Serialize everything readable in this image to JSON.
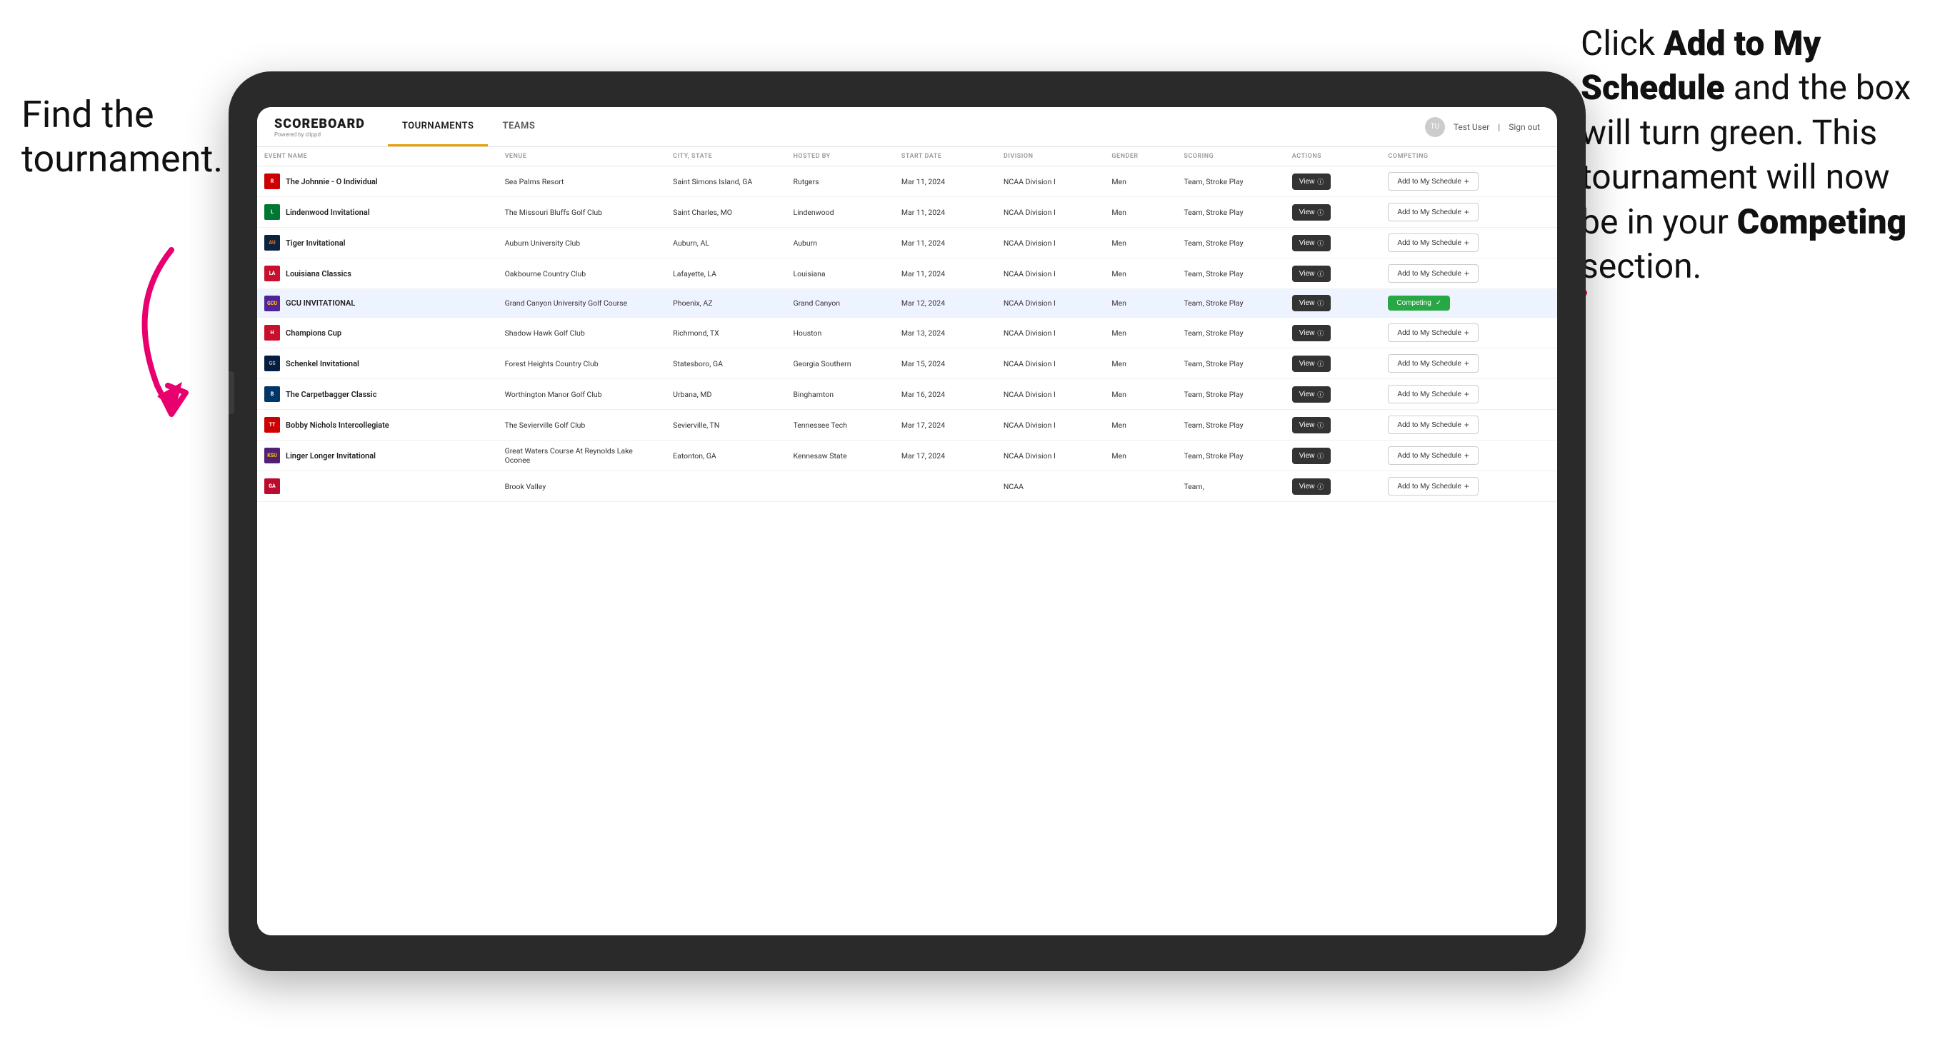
{
  "annotations": {
    "left_title": "Find the tournament.",
    "right_title_part1": "Click ",
    "right_bold1": "Add to My Schedule",
    "right_part2": " and the box will turn green. This tournament will now be in your ",
    "right_bold2": "Competing",
    "right_part3": " section."
  },
  "header": {
    "logo": "SCOREBOARD",
    "logo_sub": "Powered by clippd",
    "nav": [
      "TOURNAMENTS",
      "TEAMS"
    ],
    "active_nav": "TOURNAMENTS",
    "user": "Test User",
    "sign_out": "Sign out"
  },
  "table": {
    "columns": [
      "EVENT NAME",
      "VENUE",
      "CITY, STATE",
      "HOSTED BY",
      "START DATE",
      "DIVISION",
      "GENDER",
      "SCORING",
      "ACTIONS",
      "COMPETING"
    ],
    "rows": [
      {
        "logo_class": "logo-r",
        "logo_text": "R",
        "event_name": "The Johnnie - O Individual",
        "venue": "Sea Palms Resort",
        "city_state": "Saint Simons Island, GA",
        "hosted_by": "Rutgers",
        "start_date": "Mar 11, 2024",
        "division": "NCAA Division I",
        "gender": "Men",
        "scoring": "Team, Stroke Play",
        "action": "View",
        "competing_label": "Add to My Schedule",
        "is_competing": false,
        "highlighted": false
      },
      {
        "logo_class": "logo-l",
        "logo_text": "L",
        "event_name": "Lindenwood Invitational",
        "venue": "The Missouri Bluffs Golf Club",
        "city_state": "Saint Charles, MO",
        "hosted_by": "Lindenwood",
        "start_date": "Mar 11, 2024",
        "division": "NCAA Division I",
        "gender": "Men",
        "scoring": "Team, Stroke Play",
        "action": "View",
        "competing_label": "Add to My Schedule",
        "is_competing": false,
        "highlighted": false
      },
      {
        "logo_class": "logo-au",
        "logo_text": "AU",
        "event_name": "Tiger Invitational",
        "venue": "Auburn University Club",
        "city_state": "Auburn, AL",
        "hosted_by": "Auburn",
        "start_date": "Mar 11, 2024",
        "division": "NCAA Division I",
        "gender": "Men",
        "scoring": "Team, Stroke Play",
        "action": "View",
        "competing_label": "Add to My Schedule",
        "is_competing": false,
        "highlighted": false
      },
      {
        "logo_class": "logo-la",
        "logo_text": "LA",
        "event_name": "Louisiana Classics",
        "venue": "Oakbourne Country Club",
        "city_state": "Lafayette, LA",
        "hosted_by": "Louisiana",
        "start_date": "Mar 11, 2024",
        "division": "NCAA Division I",
        "gender": "Men",
        "scoring": "Team, Stroke Play",
        "action": "View",
        "competing_label": "Add to My Schedule",
        "is_competing": false,
        "highlighted": false
      },
      {
        "logo_class": "logo-gcu",
        "logo_text": "GCU",
        "event_name": "GCU INVITATIONAL",
        "venue": "Grand Canyon University Golf Course",
        "city_state": "Phoenix, AZ",
        "hosted_by": "Grand Canyon",
        "start_date": "Mar 12, 2024",
        "division": "NCAA Division I",
        "gender": "Men",
        "scoring": "Team, Stroke Play",
        "action": "View",
        "competing_label": "Competing",
        "is_competing": true,
        "highlighted": true
      },
      {
        "logo_class": "logo-uh",
        "logo_text": "H",
        "event_name": "Champions Cup",
        "venue": "Shadow Hawk Golf Club",
        "city_state": "Richmond, TX",
        "hosted_by": "Houston",
        "start_date": "Mar 13, 2024",
        "division": "NCAA Division I",
        "gender": "Men",
        "scoring": "Team, Stroke Play",
        "action": "View",
        "competing_label": "Add to My Schedule",
        "is_competing": false,
        "highlighted": false
      },
      {
        "logo_class": "logo-gs",
        "logo_text": "GS",
        "event_name": "Schenkel Invitational",
        "venue": "Forest Heights Country Club",
        "city_state": "Statesboro, GA",
        "hosted_by": "Georgia Southern",
        "start_date": "Mar 15, 2024",
        "division": "NCAA Division I",
        "gender": "Men",
        "scoring": "Team, Stroke Play",
        "action": "View",
        "competing_label": "Add to My Schedule",
        "is_competing": false,
        "highlighted": false
      },
      {
        "logo_class": "logo-bi",
        "logo_text": "B",
        "event_name": "The Carpetbagger Classic",
        "venue": "Worthington Manor Golf Club",
        "city_state": "Urbana, MD",
        "hosted_by": "Binghamton",
        "start_date": "Mar 16, 2024",
        "division": "NCAA Division I",
        "gender": "Men",
        "scoring": "Team, Stroke Play",
        "action": "View",
        "competing_label": "Add to My Schedule",
        "is_competing": false,
        "highlighted": false
      },
      {
        "logo_class": "logo-tt",
        "logo_text": "TT",
        "event_name": "Bobby Nichols Intercollegiate",
        "venue": "The Sevierville Golf Club",
        "city_state": "Sevierville, TN",
        "hosted_by": "Tennessee Tech",
        "start_date": "Mar 17, 2024",
        "division": "NCAA Division I",
        "gender": "Men",
        "scoring": "Team, Stroke Play",
        "action": "View",
        "competing_label": "Add to My Schedule",
        "is_competing": false,
        "highlighted": false
      },
      {
        "logo_class": "logo-ksu",
        "logo_text": "KSU",
        "event_name": "Linger Longer Invitational",
        "venue": "Great Waters Course At Reynolds Lake Oconee",
        "city_state": "Eatonton, GA",
        "hosted_by": "Kennesaw State",
        "start_date": "Mar 17, 2024",
        "division": "NCAA Division I",
        "gender": "Men",
        "scoring": "Team, Stroke Play",
        "action": "View",
        "competing_label": "Add to My Schedule",
        "is_competing": false,
        "highlighted": false
      },
      {
        "logo_class": "logo-ga",
        "logo_text": "GA",
        "event_name": "",
        "venue": "Brook Valley",
        "city_state": "",
        "hosted_by": "",
        "start_date": "",
        "division": "NCAA",
        "gender": "",
        "scoring": "Team,",
        "action": "View",
        "competing_label": "Add to My Schedule",
        "is_competing": false,
        "highlighted": false
      }
    ]
  }
}
